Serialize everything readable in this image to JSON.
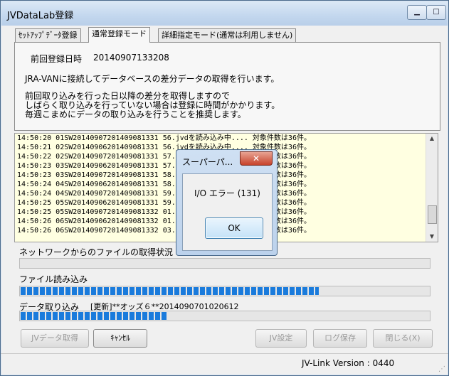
{
  "window": {
    "title": "JVDataLab登録"
  },
  "tabs": [
    {
      "label": "ｾｯﾄｱｯﾌﾟﾃﾞｰﾀ登録"
    },
    {
      "label": "通常登録モード"
    },
    {
      "label": "詳細指定モード(通常は利用しません)"
    }
  ],
  "panel": {
    "last_reg_label": "前回登録日時",
    "last_reg_value": "20140907133208",
    "desc1": "JRA-VANに接続してデータベースの差分データの取得を行います。",
    "desc2": "前回取り込みを行った日以降の差分を取得しますので",
    "desc3": "しばらく取り込みを行っていない場合は登録に時間がかかります。",
    "desc4": "毎週こまめにデータの取り込みを行うことを推奨します。"
  },
  "log": [
    "14:50:20 01SW20140907201409081331 56.jvdを読み込み中.... 対象件数は36件。",
    "14:50:21 02SW20140906201409081331 56.jvdを読み込み中.... 対象件数は36件。",
    "14:50:22 02SW20140907201409081331 57.jvdを読み込み中.... 対象件数は36件。",
    "14:50:23 03SW20140906201409081331 57.jvdを読み込み中.... 対象件数は36件。",
    "14:50:23 03SW20140907201409081331 58.jvdを読み込み中.... 対象件数は36件。",
    "14:50:24 04SW20140906201409081331 58.jvdを読み込み中.... 対象件数は36件。",
    "14:50:24 04SW20140907201409081331 59.jvdを読み込み中.... 対象件数は36件。",
    "14:50:25 05SW20140906201409081331 59.jvdを読み込み中.... 対象件数は36件。",
    "14:50:25 05SW20140907201409081332 01.jvdを読み込み中.... 対象件数は36件。",
    "14:50:26 06SW20140906201409081332 01.jvdを読み込み中.... 対象件数は36件。",
    "14:50:26 06SW20140907201409081332 03.jvdを読み込み中.... 対象件数は36件。"
  ],
  "progress": {
    "network_label": "ネットワークからのファイルの取得状況",
    "network_fraction": 0,
    "file_label": "ファイル読み込み",
    "file_fraction": 0.73,
    "data_label": "データ取り込み",
    "data_detail": "[更新]**オッズ６**2014090701020612",
    "data_fraction": 0.36
  },
  "buttons": {
    "jv_fetch": "JVデータ取得",
    "cancel": "ｷｬﾝｾﾙ",
    "jv_settings": "JV設定",
    "save_log": "ログ保存",
    "close": "閉じる(X)"
  },
  "status": {
    "version": "JV-Link Version : 0440"
  },
  "dialog": {
    "title": "スーパーパ...",
    "message": "I/O エラー (131)",
    "ok": "OK",
    "close_glyph": "✕"
  },
  "icons": {
    "minimize": "▁",
    "maximize": "□",
    "close": "✕",
    "scroll_up": "▲",
    "scroll_down": "▼",
    "grip": "⋰"
  }
}
